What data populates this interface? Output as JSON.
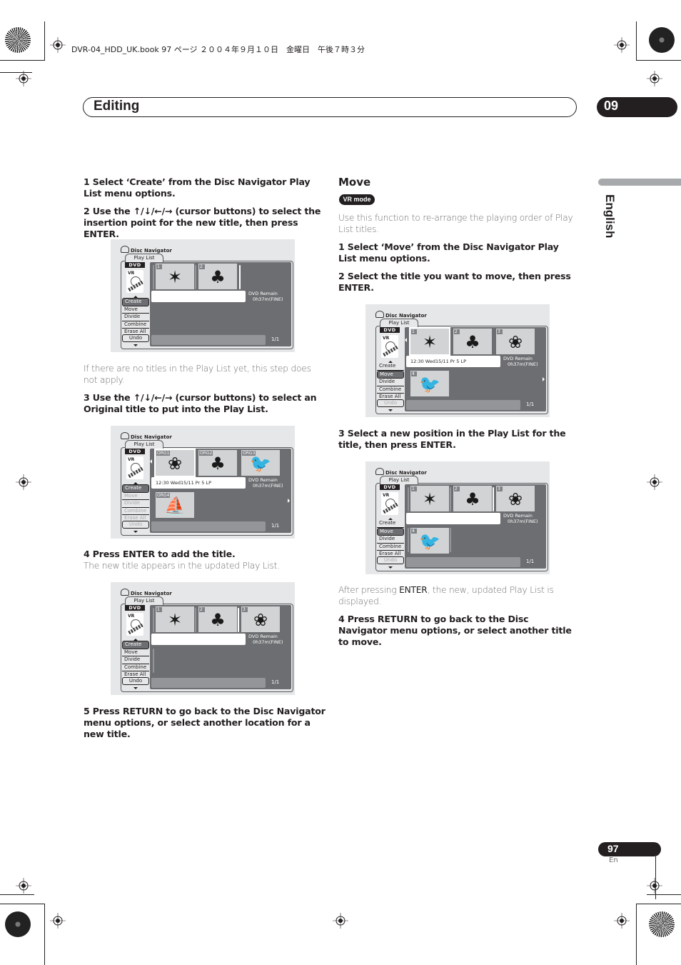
{
  "print_header": "DVR-04_HDD_UK.book  97 ページ  ２００４年９月１０日　金曜日　午後７時３分",
  "section": {
    "title": "Editing",
    "chapter": "09"
  },
  "language_tab": "English",
  "left_column": {
    "step1": "1    Select ‘Create’ from the Disc Navigator Play List menu options.",
    "step2": "2    Use the ↑/↓/←/→ (cursor buttons) to select the insertion point for the new title, then press ENTER.",
    "note1": "If there are no titles in the Play List yet, this step does not apply.",
    "step3": "3    Use the ↑/↓/←/→ (cursor buttons) to select an Original title to put into the Play List.",
    "step4": "4    Press ENTER to add the title.",
    "note4": "The new title appears in the updated Play List.",
    "step5": "5    Press RETURN to go back to the Disc Navigator menu options, or select another location for a new title."
  },
  "right_column": {
    "heading": "Move",
    "badge": "VR mode",
    "intro": "Use this function to re-arrange the playing order of Play List titles.",
    "step1": "1    Select ‘Move’ from the Disc Navigator Play List menu options.",
    "step2": "2    Select the title you want to move, then press ENTER.",
    "step3": "3    Select a new position in the Play List for the title, then press ENTER.",
    "note3_prefix": "After pressing ",
    "note3_bold": "ENTER",
    "note3_suffix": ", the new, updated Play List is displayed.",
    "step4": "4    Press RETURN to go back to the Disc Navigator menu options, or select another title to move."
  },
  "screen_common": {
    "app_title": "Disc Navigator",
    "tab": "Play List",
    "disc_label": "DVD",
    "vr_label": "VR",
    "menu": [
      "Create",
      "Move",
      "Divide",
      "Combine",
      "Erase All"
    ],
    "undo": "Undo",
    "remain_line1": "DVD Remain",
    "remain_line2": "0h37m(FINE)",
    "page": "1/1",
    "info": "12:30 Wed15/11  Pr 5   LP"
  },
  "screens": [
    {
      "id": "create-1",
      "selected_menu": "Create",
      "thumbs": [
        {
          "label": "1",
          "picture": "leaf-icon"
        },
        {
          "label": "2",
          "picture": "tree-icon"
        }
      ]
    },
    {
      "id": "create-2",
      "selected_menu": "Create",
      "thumbs": [
        {
          "label": "ORG1",
          "picture": "lily-icon"
        },
        {
          "label": "ORG2",
          "picture": "tree-icon"
        },
        {
          "label": "ORG3",
          "picture": "toucan-icon"
        },
        {
          "label": "ORG4",
          "picture": "windsurf-icon"
        }
      ]
    },
    {
      "id": "create-3",
      "selected_menu": "Create",
      "thumbs": [
        {
          "label": "1",
          "picture": "leaf-icon"
        },
        {
          "label": "2",
          "picture": "tree-icon"
        },
        {
          "label": "3",
          "picture": "lily-icon"
        }
      ]
    },
    {
      "id": "move-1",
      "selected_menu": "Move",
      "thumbs": [
        {
          "label": "1",
          "picture": "leaf-icon"
        },
        {
          "label": "2",
          "picture": "tree-icon"
        },
        {
          "label": "3",
          "picture": "lily-icon"
        },
        {
          "label": "4",
          "picture": "toucan-icon"
        }
      ]
    },
    {
      "id": "move-2",
      "selected_menu": "Move",
      "thumbs": [
        {
          "label": "1",
          "picture": "leaf-icon"
        },
        {
          "label": "2",
          "picture": "tree-icon"
        },
        {
          "label": "3",
          "picture": "lily-icon"
        },
        {
          "label": "4",
          "picture": "toucan-icon"
        }
      ]
    }
  ],
  "icons": {
    "leaf-icon": "✶",
    "tree-icon": "♣",
    "lily-icon": "❀",
    "toucan-icon": "🐦",
    "windsurf-icon": "⛵"
  },
  "footer": {
    "page_number": "97",
    "language": "En"
  }
}
